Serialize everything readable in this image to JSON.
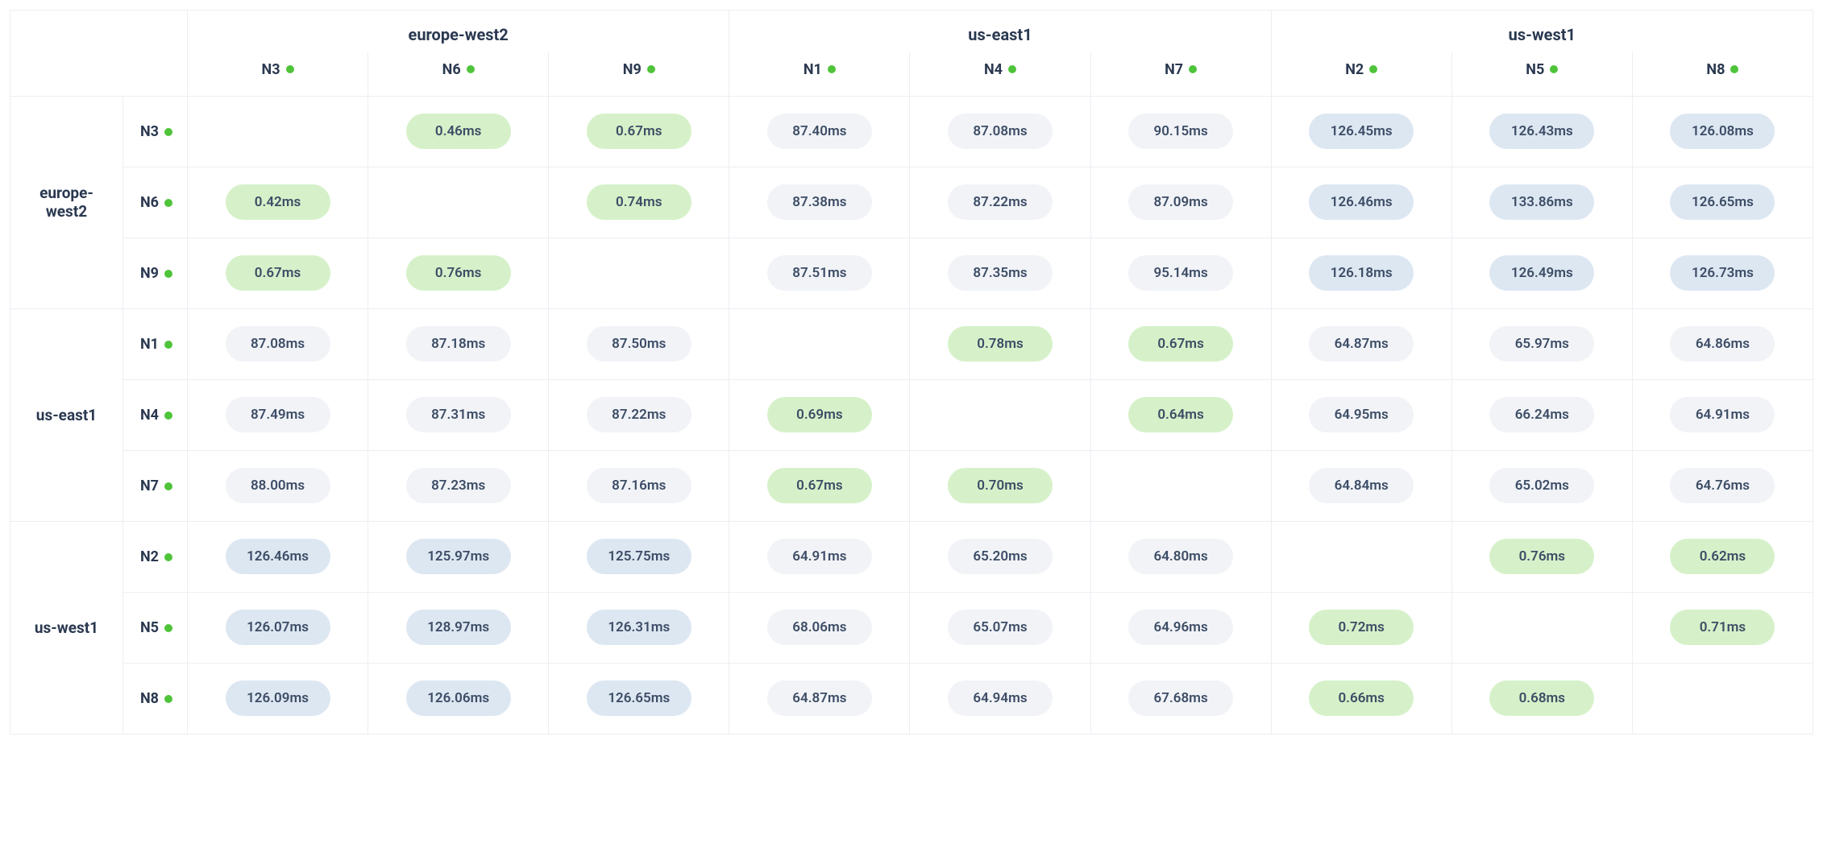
{
  "regions": [
    {
      "name": "europe-west2",
      "nodes": [
        "N3",
        "N6",
        "N9"
      ]
    },
    {
      "name": "us-east1",
      "nodes": [
        "N1",
        "N4",
        "N7"
      ]
    },
    {
      "name": "us-west1",
      "nodes": [
        "N2",
        "N5",
        "N8"
      ]
    }
  ],
  "node_status_color": "#4fc43a",
  "latency_tiers": {
    "green": {
      "bg": "#d6f1c9"
    },
    "grey": {
      "bg": "#f1f3f7"
    },
    "blue": {
      "bg": "#dde7f2"
    }
  },
  "matrix": {
    "N3": {
      "N3": null,
      "N6": "0.46ms",
      "N9": "0.67ms",
      "N1": "87.40ms",
      "N4": "87.08ms",
      "N7": "90.15ms",
      "N2": "126.45ms",
      "N5": "126.43ms",
      "N8": "126.08ms"
    },
    "N6": {
      "N3": "0.42ms",
      "N6": null,
      "N9": "0.74ms",
      "N1": "87.38ms",
      "N4": "87.22ms",
      "N7": "87.09ms",
      "N2": "126.46ms",
      "N5": "133.86ms",
      "N8": "126.65ms"
    },
    "N9": {
      "N3": "0.67ms",
      "N6": "0.76ms",
      "N9": null,
      "N1": "87.51ms",
      "N4": "87.35ms",
      "N7": "95.14ms",
      "N2": "126.18ms",
      "N5": "126.49ms",
      "N8": "126.73ms"
    },
    "N1": {
      "N3": "87.08ms",
      "N6": "87.18ms",
      "N9": "87.50ms",
      "N1": null,
      "N4": "0.78ms",
      "N7": "0.67ms",
      "N2": "64.87ms",
      "N5": "65.97ms",
      "N8": "64.86ms"
    },
    "N4": {
      "N3": "87.49ms",
      "N6": "87.31ms",
      "N9": "87.22ms",
      "N1": "0.69ms",
      "N4": null,
      "N7": "0.64ms",
      "N2": "64.95ms",
      "N5": "66.24ms",
      "N8": "64.91ms"
    },
    "N7": {
      "N3": "88.00ms",
      "N6": "87.23ms",
      "N9": "87.16ms",
      "N1": "0.67ms",
      "N4": "0.70ms",
      "N7": null,
      "N2": "64.84ms",
      "N5": "65.02ms",
      "N8": "64.76ms"
    },
    "N2": {
      "N3": "126.46ms",
      "N6": "125.97ms",
      "N9": "125.75ms",
      "N1": "64.91ms",
      "N4": "65.20ms",
      "N7": "64.80ms",
      "N2": null,
      "N5": "0.76ms",
      "N8": "0.62ms"
    },
    "N5": {
      "N3": "126.07ms",
      "N6": "128.97ms",
      "N9": "126.31ms",
      "N1": "68.06ms",
      "N4": "65.07ms",
      "N7": "64.96ms",
      "N2": "0.72ms",
      "N5": null,
      "N8": "0.71ms"
    },
    "N8": {
      "N3": "126.09ms",
      "N6": "126.06ms",
      "N9": "126.65ms",
      "N1": "64.87ms",
      "N4": "64.94ms",
      "N7": "67.68ms",
      "N2": "0.66ms",
      "N5": "0.68ms",
      "N8": null
    }
  }
}
